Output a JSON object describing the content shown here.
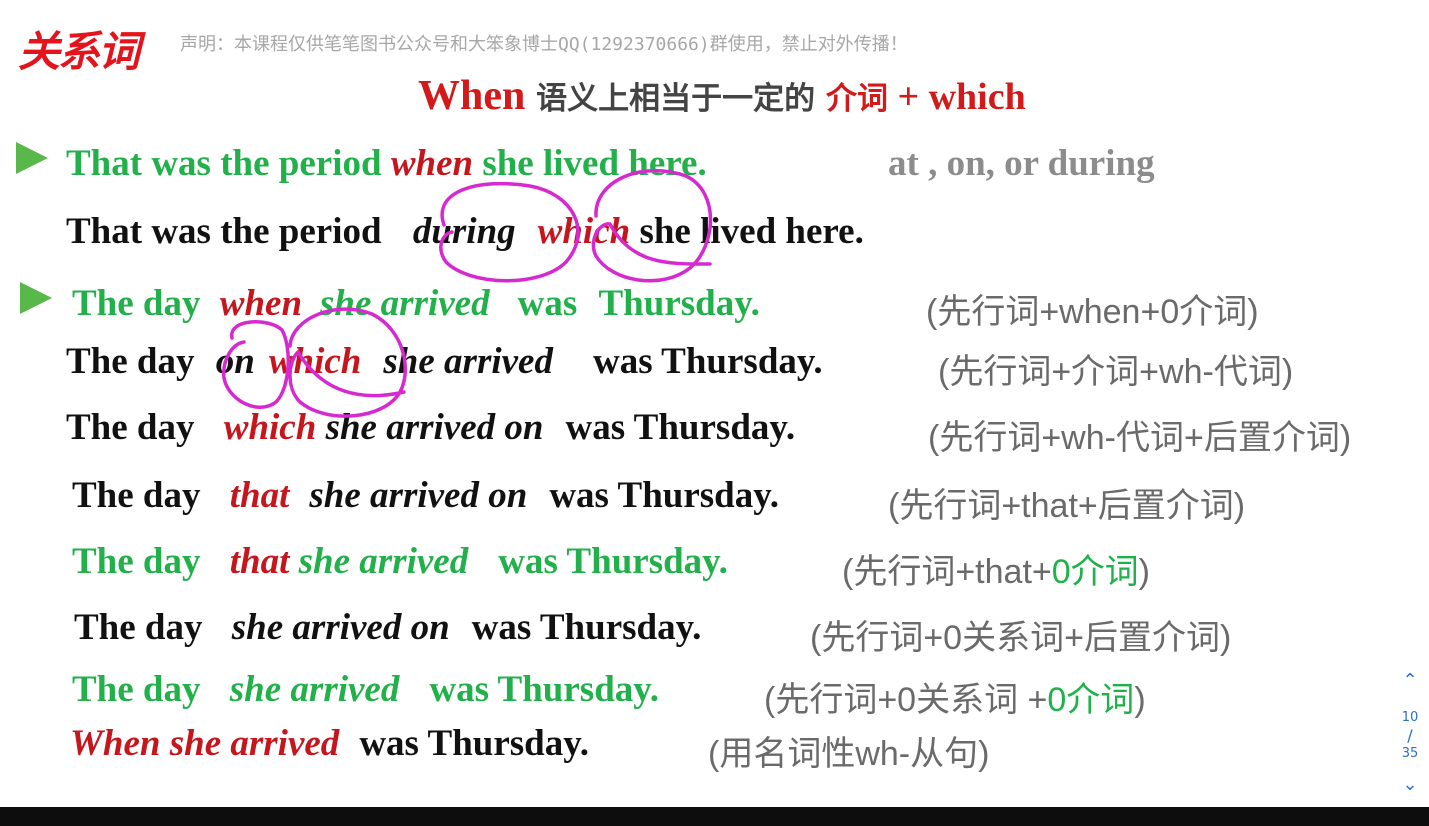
{
  "header": {
    "logo_text": "关系词",
    "notice": "声明：本课程仅供笔笔图书公众号和大笨象博士QQ(1292370666)群使用，禁止对外传播！"
  },
  "heading": {
    "when": "When",
    "middle": " 语义上相当于一定的 ",
    "prep": "介词",
    "plus": " + which"
  },
  "rows": {
    "r1": {
      "a": "That was the period ",
      "b": "when",
      "c": " she lived here.",
      "note": "at , on, or during"
    },
    "r2": {
      "a": "That was the period ",
      "b": "during",
      "c": "which",
      "d": " she lived here."
    },
    "r3": {
      "a": "The day ",
      "b": "when",
      "c": "she arrived",
      "d": "was ",
      "e": "Thursday.",
      "note": "(先行词+when+0介词)"
    },
    "r4": {
      "a": "The day ",
      "b": "on",
      "c": "which",
      "d": "she arrived",
      "e": "was  Thursday.",
      "note": "(先行词+介词+wh-代词)"
    },
    "r5": {
      "a": "The day ",
      "b": "which",
      "c": " she arrived  on",
      "d": "was Thursday.",
      "note": "(先行词+wh-代词+后置介词)"
    },
    "r6": {
      "a": "The day ",
      "b": "that",
      "c": "she arrived on",
      "d": "was Thursday.",
      "note": "(先行词+that+后置介词)"
    },
    "r7": {
      "a": "The day ",
      "b": "that",
      "c": " she arrived",
      "d": "was Thursday.",
      "note_a": "(先行词+that+",
      "note_b": "0介词",
      "note_c": ")"
    },
    "r8": {
      "a": "The day ",
      "b": "she arrived on",
      "c": "was Thursday.",
      "note": "(先行词+0关系词+后置介词)"
    },
    "r9": {
      "a": "The day ",
      "b": "she arrived",
      "c": "was Thursday.",
      "note_a": "(先行词+0关系词 +",
      "note_b": "0介词",
      "note_c": ")"
    },
    "r10": {
      "a": "When she arrived",
      "b": "was Thursday.",
      "note": "(用名词性wh-从句)"
    }
  },
  "pager": {
    "up_icon": "chevron-up-icon",
    "current": "10",
    "separator": "/",
    "total": "35",
    "down_icon": "chevron-down-icon"
  },
  "colors": {
    "green": "#22b04b",
    "red": "#c4161c",
    "black": "#111111",
    "gray": "#8c8c8c",
    "annotation": "#d62ad0",
    "pager": "#2a6fc9"
  }
}
